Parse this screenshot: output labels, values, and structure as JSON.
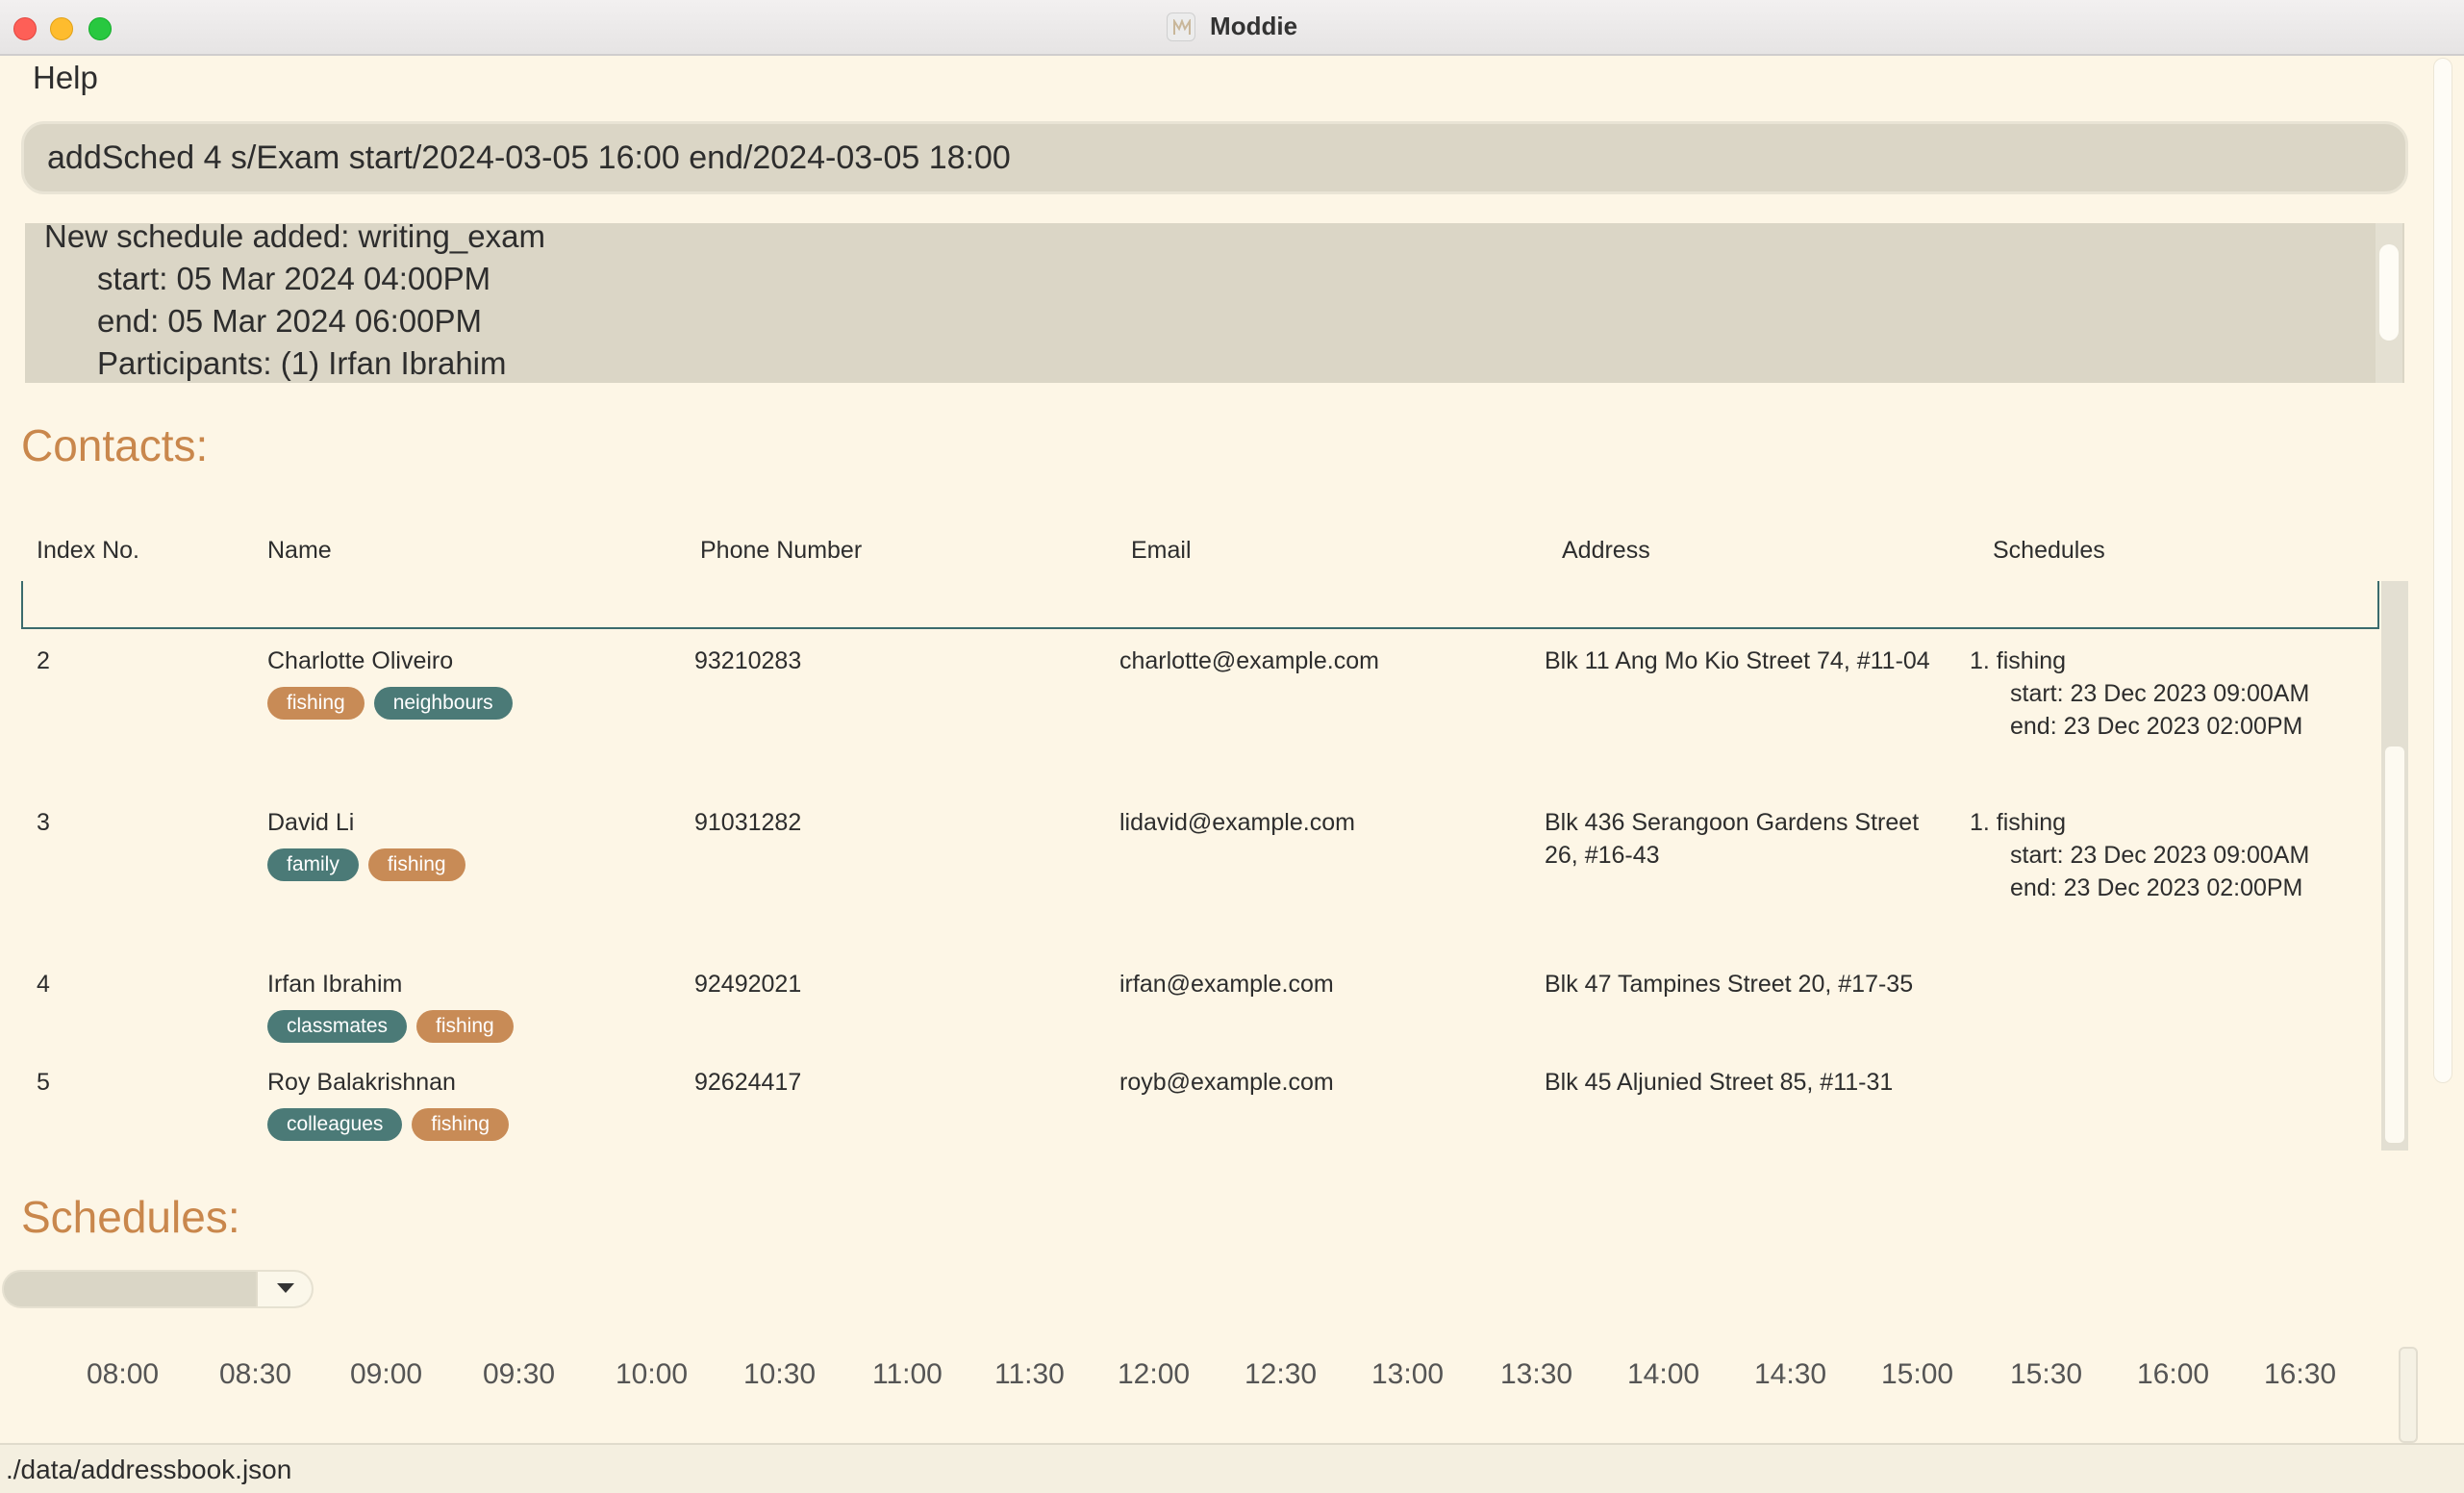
{
  "window": {
    "title": "Moddie"
  },
  "menu": {
    "help": "Help"
  },
  "command": {
    "value": "addSched 4 s/Exam start/2024-03-05 16:00 end/2024-03-05 18:00"
  },
  "result": {
    "lines": [
      "New schedule added: writing_exam",
      "      start: 05 Mar 2024 04:00PM",
      "      end: 05 Mar 2024 06:00PM",
      "      Participants: (1) Irfan Ibrahim"
    ]
  },
  "contacts": {
    "heading": "Contacts:",
    "columns": [
      "Index No.",
      "Name",
      "Phone Number",
      "Email",
      "Address",
      "Schedules"
    ],
    "rows": [
      {
        "index": "2",
        "name": "Charlotte Oliveiro",
        "phone": "93210283",
        "email": "charlotte@example.com",
        "address": [
          "Blk 11 Ang Mo Kio Street 74, #11-04"
        ],
        "tags": [
          {
            "label": "fishing",
            "color": "#c88b56"
          },
          {
            "label": "neighbours",
            "color": "#4b7a77"
          }
        ],
        "schedules": [
          "1. fishing",
          "start: 23 Dec 2023 09:00AM",
          "end: 23 Dec 2023 02:00PM"
        ]
      },
      {
        "index": "3",
        "name": "David Li",
        "phone": "91031282",
        "email": "lidavid@example.com",
        "address": [
          "Blk 436 Serangoon Gardens Street",
          "26, #16-43"
        ],
        "tags": [
          {
            "label": "family",
            "color": "#4b7a77"
          },
          {
            "label": "fishing",
            "color": "#c88b56"
          }
        ],
        "schedules": [
          "1. fishing",
          "start: 23 Dec 2023 09:00AM",
          "end: 23 Dec 2023 02:00PM"
        ]
      },
      {
        "index": "4",
        "name": "Irfan Ibrahim",
        "phone": "92492021",
        "email": "irfan@example.com",
        "address": [
          "Blk 47 Tampines Street 20, #17-35"
        ],
        "tags": [
          {
            "label": "classmates",
            "color": "#4b7a77"
          },
          {
            "label": "fishing",
            "color": "#c88b56"
          }
        ],
        "schedules": []
      },
      {
        "index": "5",
        "name": "Roy Balakrishnan",
        "phone": "92624417",
        "email": "royb@example.com",
        "address": [
          "Blk 45 Aljunied Street 85, #11-31"
        ],
        "tags": [
          {
            "label": "colleagues",
            "color": "#4b7a77"
          },
          {
            "label": "fishing",
            "color": "#c88b56"
          }
        ],
        "schedules": []
      }
    ]
  },
  "schedules": {
    "heading": "Schedules:",
    "dropdown_value": "",
    "times": [
      "08:00",
      "08:30",
      "09:00",
      "09:30",
      "10:00",
      "10:30",
      "11:00",
      "11:30",
      "12:00",
      "12:30",
      "13:00",
      "13:30",
      "14:00",
      "14:30",
      "15:00",
      "15:30",
      "16:00",
      "16:30"
    ]
  },
  "status": {
    "path": "./data/addressbook.json"
  },
  "colors": {
    "accent": "#c9874c",
    "tag_teal": "#4b7a77",
    "tag_orange": "#c88b56",
    "background": "#fdf6e6"
  }
}
